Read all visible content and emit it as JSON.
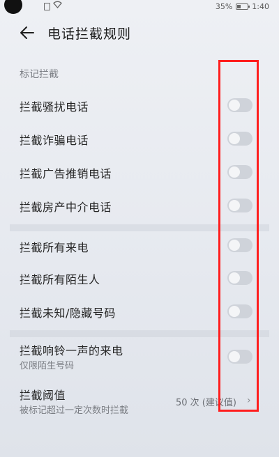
{
  "status_bar": {
    "battery_percent": "35%",
    "time": "1:40"
  },
  "header": {
    "title": "电话拦截规则"
  },
  "section": {
    "label": "标记拦截"
  },
  "rows": [
    {
      "label": "拦截骚扰电话",
      "enabled": false
    },
    {
      "label": "拦截诈骗电话",
      "enabled": false
    },
    {
      "label": "拦截广告推销电话",
      "enabled": false
    },
    {
      "label": "拦截房产中介电话",
      "enabled": false
    },
    {
      "label": "拦截所有来电",
      "enabled": false
    },
    {
      "label": "拦截所有陌生人",
      "enabled": false
    },
    {
      "label": "拦截未知/隐藏号码",
      "enabled": false
    },
    {
      "label": "拦截响铃一声的来电",
      "sublabel": "仅限陌生号码",
      "enabled": false
    }
  ],
  "threshold": {
    "label": "拦截阈值",
    "sublabel": "被标记超过一定次数时拦截",
    "value": "50 次 (建议值)"
  },
  "colors": {
    "highlight": "#ff1e1e",
    "toggle_off": "#cfd3da"
  }
}
